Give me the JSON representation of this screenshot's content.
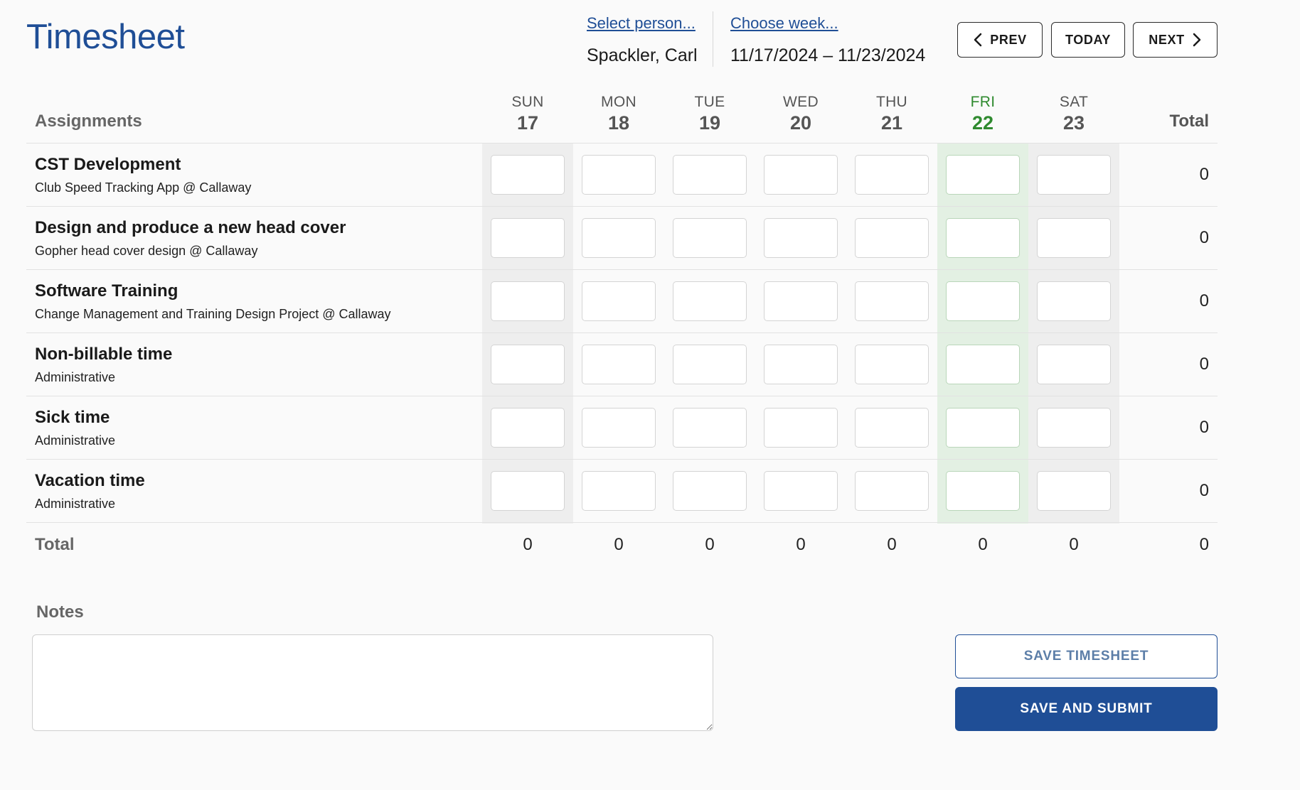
{
  "app": {
    "title": "Timesheet"
  },
  "person": {
    "link": "Select person...",
    "value": "Spackler, Carl"
  },
  "week": {
    "link": "Choose week...",
    "value": "11/17/2024 – 11/23/2024"
  },
  "nav": {
    "prev": "PREV",
    "today": "TODAY",
    "next": "NEXT"
  },
  "table": {
    "assignments_header": "Assignments",
    "total_header": "Total",
    "days": [
      {
        "name": "SUN",
        "num": "17",
        "today": false
      },
      {
        "name": "MON",
        "num": "18",
        "today": false
      },
      {
        "name": "TUE",
        "num": "19",
        "today": false
      },
      {
        "name": "WED",
        "num": "20",
        "today": false
      },
      {
        "name": "THU",
        "num": "21",
        "today": false
      },
      {
        "name": "FRI",
        "num": "22",
        "today": true
      },
      {
        "name": "SAT",
        "num": "23",
        "today": false
      }
    ],
    "rows": [
      {
        "name": "CST Development",
        "sub": "Club Speed Tracking App @ Callaway",
        "hours": [
          "",
          "",
          "",
          "",
          "",
          "",
          ""
        ],
        "total": "0"
      },
      {
        "name": "Design and produce a new head cover",
        "sub": "Gopher head cover design @ Callaway",
        "hours": [
          "",
          "",
          "",
          "",
          "",
          "",
          ""
        ],
        "total": "0"
      },
      {
        "name": "Software Training",
        "sub": "Change Management and Training Design Project @ Callaway",
        "hours": [
          "",
          "",
          "",
          "",
          "",
          "",
          ""
        ],
        "total": "0"
      },
      {
        "name": "Non-billable time",
        "sub": "Administrative",
        "hours": [
          "",
          "",
          "",
          "",
          "",
          "",
          ""
        ],
        "total": "0"
      },
      {
        "name": "Sick time",
        "sub": "Administrative",
        "hours": [
          "",
          "",
          "",
          "",
          "",
          "",
          ""
        ],
        "total": "0"
      },
      {
        "name": "Vacation time",
        "sub": "Administrative",
        "hours": [
          "",
          "",
          "",
          "",
          "",
          "",
          ""
        ],
        "total": "0"
      }
    ],
    "totals_label": "Total",
    "day_totals": [
      "0",
      "0",
      "0",
      "0",
      "0",
      "0",
      "0"
    ],
    "grand_total": "0"
  },
  "notes": {
    "label": "Notes",
    "value": ""
  },
  "actions": {
    "save": "SAVE TIMESHEET",
    "submit": "SAVE AND SUBMIT"
  },
  "colors": {
    "brand": "#1f4e96",
    "today": "#2f8a2f",
    "today_column_bg": "#e3f0e3",
    "weekend_column_bg": "#eeeeee"
  }
}
